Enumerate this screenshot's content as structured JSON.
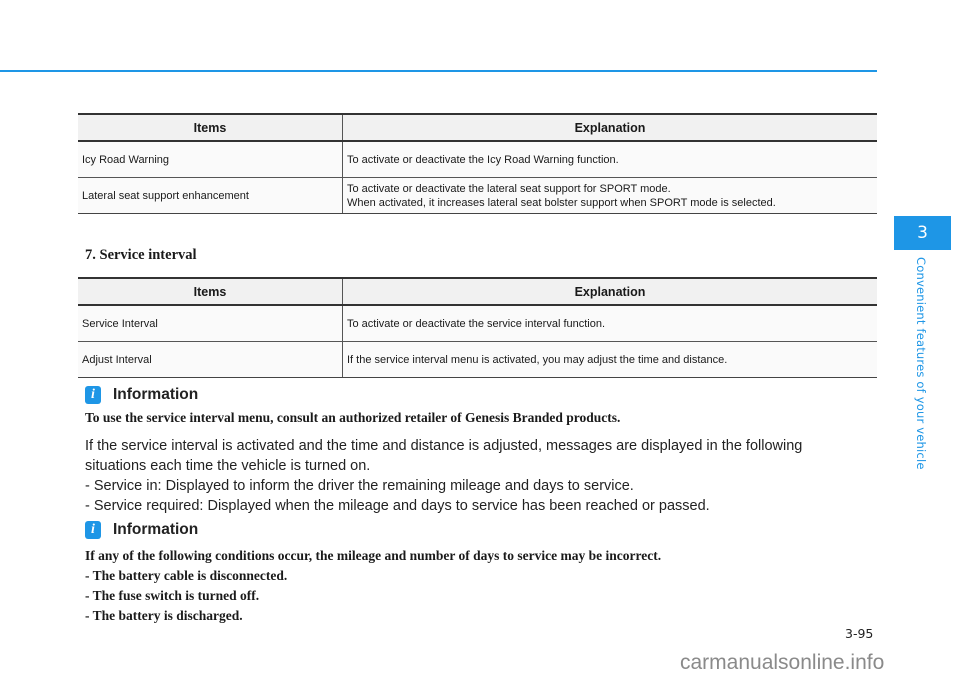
{
  "chapter": {
    "number": "3",
    "title": "Convenient features of your vehicle",
    "accent_color": "#1e96e6"
  },
  "table1": {
    "headers": [
      "Items",
      "Explanation"
    ],
    "rows": [
      {
        "item": "Icy Road Warning",
        "explanation": [
          "To activate or deactivate the Icy Road Warning function."
        ]
      },
      {
        "item": "Lateral seat support enhancement",
        "explanation": [
          "To activate or deactivate the lateral seat support for SPORT mode.",
          "When activated, it increases lateral seat bolster support when SPORT mode is selected."
        ]
      }
    ]
  },
  "section": {
    "title": "7. Service interval"
  },
  "table2": {
    "headers": [
      "Items",
      "Explanation"
    ],
    "rows": [
      {
        "item": "Service Interval",
        "explanation": "To activate or deactivate the service interval function."
      },
      {
        "item": "Adjust Interval",
        "explanation": "If the service interval menu is activated, you may adjust the time and distance."
      }
    ]
  },
  "info1": {
    "icon": "info-icon",
    "icon_glyph": "i",
    "heading": "Information",
    "note": "To use the service interval menu, consult an authorized retailer of Genesis Branded products.",
    "paragraph_lines": [
      "If the service interval is activated and the time and distance is adjusted, messages are displayed in the following",
      "situations each time the vehicle is turned on.",
      "- Service in: Displayed to inform the driver the remaining mileage and days to service.",
      "- Service required: Displayed when the mileage and days to service has been reached or passed."
    ]
  },
  "info2": {
    "icon": "info-icon",
    "icon_glyph": "i",
    "heading": "Information",
    "lines": [
      "If any of the following conditions occur, the mileage and number of days to service may be incorrect.",
      "- The battery cable is disconnected.",
      "- The fuse switch is turned off.",
      "- The battery is discharged."
    ]
  },
  "footer": {
    "page_number": "3-95",
    "watermark": "carmanualsonline.info"
  }
}
